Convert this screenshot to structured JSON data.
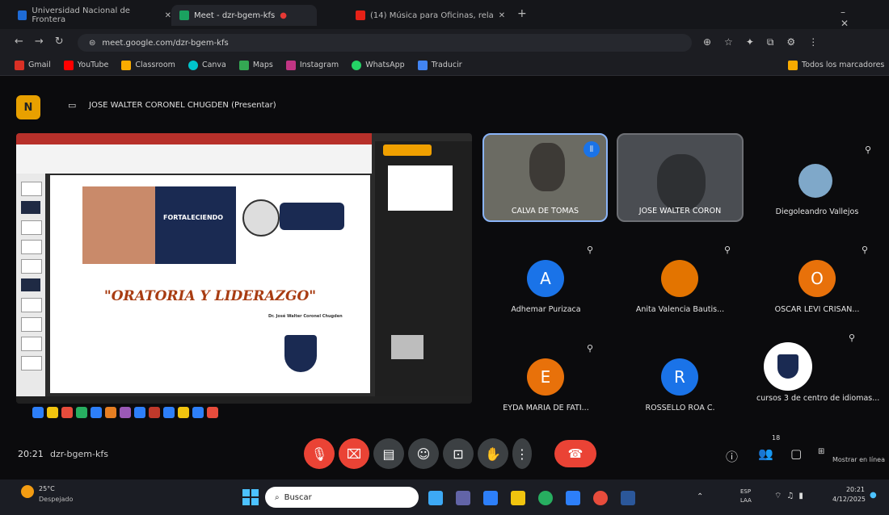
{
  "browser": {
    "tabs": [
      {
        "label": "Universidad Nacional de Frontera",
        "color": "#1e6bd6"
      },
      {
        "label": "Meet - dzr-bgem-kfs",
        "color": "#1aa260"
      },
      {
        "label": "(14) Música para Oficinas, rela",
        "color": "#e62117"
      }
    ],
    "url": "meet.google.com/dzr-bgem-kfs",
    "bookmarks": [
      "Gmail",
      "YouTube",
      "Classroom",
      "Canva",
      "Maps",
      "Instagram",
      "WhatsApp",
      "Traducir"
    ],
    "all_bookmarks": "Todos los marcadores"
  },
  "meet": {
    "presenter_label": "JOSE WALTER CORONEL CHUGDEN (Presentar)",
    "slide": {
      "title": "\"ORATORIA Y LIDERAZGO\"",
      "author": "Dr. José Walter Coronel Chugden",
      "banner": "FORTALECIENDO"
    },
    "video_tiles": [
      {
        "name": "CALVA DE TOMAS",
        "accent": "#8ab4f8"
      },
      {
        "name": "JOSE WALTER CORON",
        "accent": "#5f6368"
      },
      {
        "name": "Diegoleandro Vallejos",
        "accent": "#3c4043"
      }
    ],
    "participants": [
      {
        "name": "Adhemar Purizaca",
        "initial": "A",
        "color": "#1a73e8"
      },
      {
        "name": "Anita Valencia Bautis...",
        "initial": "",
        "color": "#e37400"
      },
      {
        "name": "OSCAR LEVI CRISAN...",
        "initial": "O",
        "color": "#e8710a"
      },
      {
        "name": "EYDA MARIA DE FATI...",
        "initial": "E",
        "color": "#e8710a"
      },
      {
        "name": "ROSSELLO ROA C.",
        "initial": "R",
        "color": "#1a73e8"
      },
      {
        "name": "cursos 3 de centro de idiomas...",
        "initial": "",
        "color": "#ffffff"
      }
    ],
    "time": "20:21",
    "meeting_code": "dzr-bgem-kfs",
    "participant_count": "18",
    "more_label": "Mostrar en línea"
  },
  "taskbar": {
    "weather_temp": "25°C",
    "weather_desc": "Despejado",
    "search": "Buscar",
    "lang": "ESP LAA",
    "clock": "20:21",
    "date": "4/12/2025"
  }
}
